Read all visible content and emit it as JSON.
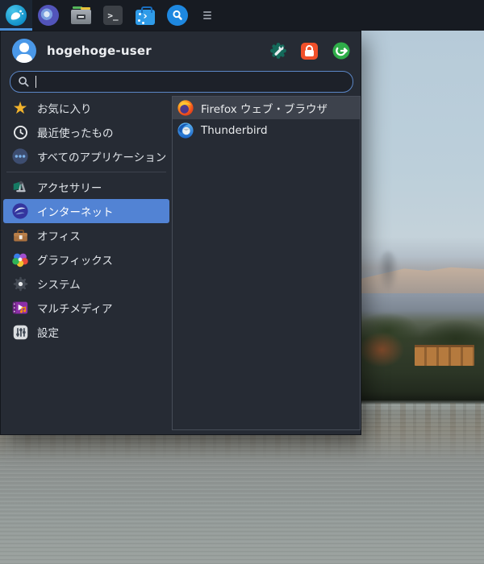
{
  "panel": {
    "buttons": [
      {
        "icon": "whisker-menu-icon",
        "active": true
      },
      {
        "icon": "web-browser-icon"
      },
      {
        "icon": "file-manager-icon"
      },
      {
        "icon": "terminal-icon"
      },
      {
        "icon": "software-toolbox-icon"
      },
      {
        "icon": "app-finder-icon"
      },
      {
        "icon": "window-menu-icon"
      }
    ]
  },
  "menu": {
    "username": "hogehoge-user",
    "header_actions": [
      {
        "icon": "settings-wrench-icon"
      },
      {
        "icon": "lock-screen-icon"
      },
      {
        "icon": "logout-icon"
      }
    ],
    "search": {
      "value": "",
      "placeholder": "",
      "icon": "search-icon"
    },
    "categories": [
      {
        "label": "お気に入り",
        "icon": "star-icon"
      },
      {
        "label": "最近使ったもの",
        "icon": "clock-icon"
      },
      {
        "label": "すべてのアプリケーション",
        "icon": "all-apps-icon"
      },
      {
        "label": "アクセサリー",
        "icon": "accessories-icon"
      },
      {
        "label": "インターネット",
        "icon": "internet-icon",
        "selected": true
      },
      {
        "label": "オフィス",
        "icon": "office-icon"
      },
      {
        "label": "グラフィックス",
        "icon": "graphics-icon"
      },
      {
        "label": "システム",
        "icon": "system-icon"
      },
      {
        "label": "マルチメディア",
        "icon": "multimedia-icon"
      },
      {
        "label": "設定",
        "icon": "settings-icon"
      }
    ],
    "apps": [
      {
        "label": "Firefox ウェブ・ブラウザ",
        "icon": "firefox-icon",
        "highlighted": true
      },
      {
        "label": "Thunderbird",
        "icon": "thunderbird-icon"
      }
    ]
  },
  "colors": {
    "selection_blue": "#5283d4",
    "panel_bg": "#171b22",
    "menu_bg": "#262b34",
    "search_border": "#5b86c6",
    "active_underline": "#4a90d9",
    "lock_orange": "#f1502a",
    "logout_green": "#2fad49",
    "star_yellow": "#f2b32c"
  }
}
